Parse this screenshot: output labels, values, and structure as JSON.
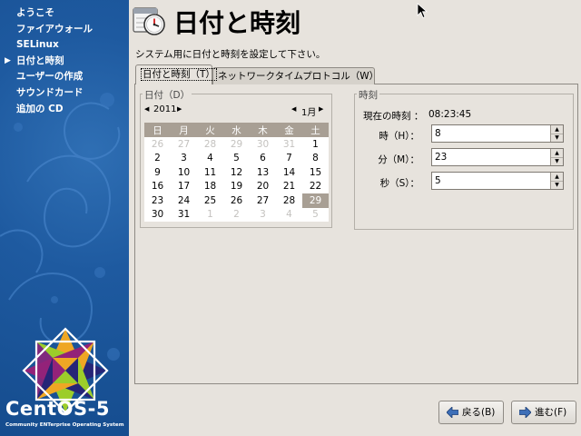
{
  "sidebar": {
    "steps": [
      {
        "label": "ようこそ",
        "current": false
      },
      {
        "label": "ファイアウォール",
        "current": false
      },
      {
        "label": "SELinux",
        "current": false
      },
      {
        "label": "日付と時刻",
        "current": true
      },
      {
        "label": "ユーザーの作成",
        "current": false
      },
      {
        "label": "サウンドカード",
        "current": false
      },
      {
        "label": "追加の CD",
        "current": false
      }
    ],
    "logo_text": "CentOS-5",
    "logo_tagline": "Community ENTerprise Operating System"
  },
  "header": {
    "title": "日付と時刻",
    "icon": "clock-calendar-icon",
    "subtitle": "システム用に日付と時刻を設定して下さい。"
  },
  "tabs": [
    {
      "label": "日付と時刻（T）",
      "active": true
    },
    {
      "label": "ネットワークタイムプロトコル（W）",
      "active": false
    }
  ],
  "date_section": {
    "label": "日付（D）",
    "year": "2011",
    "month": "1月",
    "weekdays": [
      "日",
      "月",
      "火",
      "水",
      "木",
      "金",
      "土"
    ],
    "weeks": [
      [
        {
          "d": "26",
          "o": true
        },
        {
          "d": "27",
          "o": true
        },
        {
          "d": "28",
          "o": true
        },
        {
          "d": "29",
          "o": true
        },
        {
          "d": "30",
          "o": true
        },
        {
          "d": "31",
          "o": true
        },
        {
          "d": "1",
          "o": false
        }
      ],
      [
        {
          "d": "2",
          "o": false
        },
        {
          "d": "3",
          "o": false
        },
        {
          "d": "4",
          "o": false
        },
        {
          "d": "5",
          "o": false
        },
        {
          "d": "6",
          "o": false
        },
        {
          "d": "7",
          "o": false
        },
        {
          "d": "8",
          "o": false
        }
      ],
      [
        {
          "d": "9",
          "o": false
        },
        {
          "d": "10",
          "o": false
        },
        {
          "d": "11",
          "o": false
        },
        {
          "d": "12",
          "o": false
        },
        {
          "d": "13",
          "o": false
        },
        {
          "d": "14",
          "o": false
        },
        {
          "d": "15",
          "o": false
        }
      ],
      [
        {
          "d": "16",
          "o": false
        },
        {
          "d": "17",
          "o": false
        },
        {
          "d": "18",
          "o": false
        },
        {
          "d": "19",
          "o": false
        },
        {
          "d": "20",
          "o": false
        },
        {
          "d": "21",
          "o": false
        },
        {
          "d": "22",
          "o": false
        }
      ],
      [
        {
          "d": "23",
          "o": false
        },
        {
          "d": "24",
          "o": false
        },
        {
          "d": "25",
          "o": false
        },
        {
          "d": "26",
          "o": false
        },
        {
          "d": "27",
          "o": false
        },
        {
          "d": "28",
          "o": false
        },
        {
          "d": "29",
          "o": false,
          "s": true
        }
      ],
      [
        {
          "d": "30",
          "o": false
        },
        {
          "d": "31",
          "o": false
        },
        {
          "d": "1",
          "o": true
        },
        {
          "d": "2",
          "o": true
        },
        {
          "d": "3",
          "o": true
        },
        {
          "d": "4",
          "o": true
        },
        {
          "d": "5",
          "o": true
        }
      ]
    ]
  },
  "time_section": {
    "label": "時刻",
    "current_label": "現在の時刻 ：",
    "current_value": "08:23:45",
    "hour_label": "時（H）：",
    "hour_value": "8",
    "minute_label": "分（M）：",
    "minute_value": "23",
    "second_label": "秒（S）：",
    "second_value": "5"
  },
  "buttons": {
    "back_label": "戻る(B)",
    "next_label": "進む(F)"
  },
  "colors": {
    "sidebar_blue": "#1e5aa0",
    "calendar_header": "#a89f94",
    "window_bg": "#e7e3dd"
  }
}
